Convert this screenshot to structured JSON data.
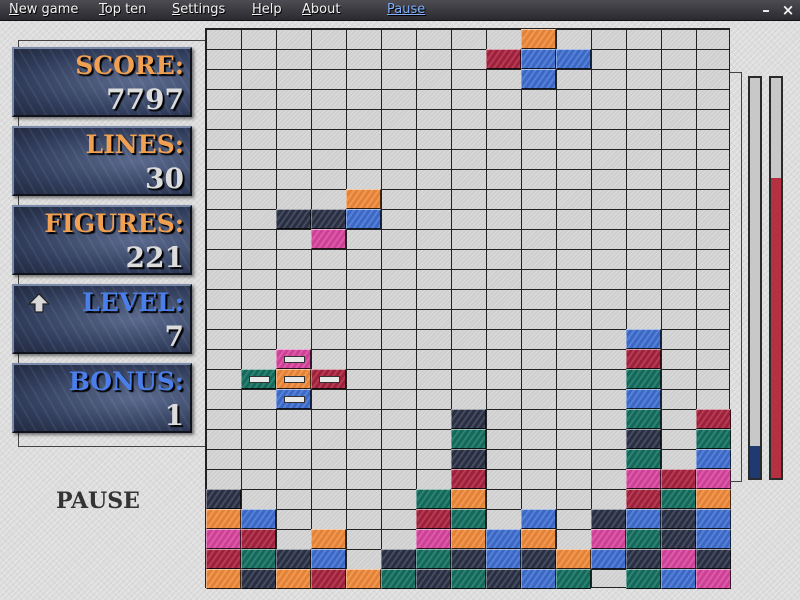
{
  "menu": {
    "items": [
      "New game",
      "Top ten",
      "Settings",
      "Help",
      "About",
      "Pause"
    ],
    "minimize_glyph": "–",
    "close_glyph": "×"
  },
  "stats": {
    "score": {
      "label": "SCORE:",
      "value": "7797"
    },
    "lines": {
      "label": "LINES:",
      "value": "30"
    },
    "figures": {
      "label": "FIGURES:",
      "value": "221"
    },
    "level": {
      "label": "LEVEL:",
      "value": "7",
      "icon": "arrow-up-icon"
    },
    "bonus": {
      "label": "BONUS:",
      "value": "1"
    }
  },
  "status_text": "PAUSE",
  "colors": {
    "O": "#f08a3a",
    "B": "#3f6fd0",
    "R": "#a8223e",
    "T": "#137060",
    "D": "#2c3247",
    "P": "#d9449e",
    "label_orange": "#f0a050",
    "label_blue": "#4a7ee8",
    "meter_blue": "#1e3a70",
    "meter_red": "#b53040"
  },
  "board": {
    "columns": 15,
    "rows": 28,
    "cells": [
      [
        0,
        9,
        "O"
      ],
      [
        1,
        8,
        "R"
      ],
      [
        1,
        9,
        "B"
      ],
      [
        1,
        10,
        "B"
      ],
      [
        2,
        9,
        "B"
      ],
      [
        8,
        4,
        "O"
      ],
      [
        9,
        2,
        "D"
      ],
      [
        9,
        3,
        "D"
      ],
      [
        9,
        4,
        "B"
      ],
      [
        10,
        3,
        "P"
      ],
      [
        15,
        12,
        "B"
      ],
      [
        16,
        12,
        "R"
      ],
      [
        17,
        12,
        "T"
      ],
      [
        18,
        12,
        "B"
      ],
      [
        19,
        7,
        "D"
      ],
      [
        19,
        12,
        "T"
      ],
      [
        19,
        14,
        "R"
      ],
      [
        20,
        7,
        "T"
      ],
      [
        20,
        12,
        "D"
      ],
      [
        20,
        14,
        "T"
      ],
      [
        21,
        7,
        "D"
      ],
      [
        21,
        12,
        "T"
      ],
      [
        21,
        14,
        "B"
      ],
      [
        22,
        7,
        "R"
      ],
      [
        22,
        12,
        "P"
      ],
      [
        22,
        13,
        "R"
      ],
      [
        22,
        14,
        "P"
      ],
      [
        23,
        0,
        "D"
      ],
      [
        23,
        6,
        "T"
      ],
      [
        23,
        7,
        "O"
      ],
      [
        23,
        12,
        "R"
      ],
      [
        23,
        13,
        "T"
      ],
      [
        23,
        14,
        "O"
      ],
      [
        24,
        0,
        "O"
      ],
      [
        24,
        1,
        "B"
      ],
      [
        24,
        6,
        "R"
      ],
      [
        24,
        7,
        "T"
      ],
      [
        24,
        9,
        "B"
      ],
      [
        24,
        11,
        "D"
      ],
      [
        24,
        12,
        "B"
      ],
      [
        24,
        13,
        "D"
      ],
      [
        24,
        14,
        "B"
      ],
      [
        25,
        0,
        "P"
      ],
      [
        25,
        1,
        "R"
      ],
      [
        25,
        3,
        "O"
      ],
      [
        25,
        6,
        "P"
      ],
      [
        25,
        7,
        "O"
      ],
      [
        25,
        8,
        "B"
      ],
      [
        25,
        9,
        "O"
      ],
      [
        25,
        11,
        "P"
      ],
      [
        25,
        12,
        "T"
      ],
      [
        25,
        13,
        "D"
      ],
      [
        25,
        14,
        "B"
      ],
      [
        26,
        0,
        "R"
      ],
      [
        26,
        1,
        "T"
      ],
      [
        26,
        2,
        "D"
      ],
      [
        26,
        3,
        "B"
      ],
      [
        26,
        5,
        "D"
      ],
      [
        26,
        6,
        "T"
      ],
      [
        26,
        7,
        "D"
      ],
      [
        26,
        8,
        "B"
      ],
      [
        26,
        9,
        "D"
      ],
      [
        26,
        10,
        "O"
      ],
      [
        26,
        11,
        "B"
      ],
      [
        26,
        12,
        "D"
      ],
      [
        26,
        13,
        "P"
      ],
      [
        26,
        14,
        "D"
      ],
      [
        27,
        0,
        "O"
      ],
      [
        27,
        1,
        "D"
      ],
      [
        27,
        2,
        "O"
      ],
      [
        27,
        3,
        "R"
      ],
      [
        27,
        4,
        "O"
      ],
      [
        27,
        5,
        "T"
      ],
      [
        27,
        6,
        "D"
      ],
      [
        27,
        7,
        "T"
      ],
      [
        27,
        8,
        "D"
      ],
      [
        27,
        9,
        "B"
      ],
      [
        27,
        10,
        "T"
      ],
      [
        27,
        12,
        "T"
      ],
      [
        27,
        13,
        "B"
      ],
      [
        27,
        14,
        "P"
      ]
    ],
    "bonus_cells": [
      [
        16,
        2,
        "P"
      ],
      [
        17,
        1,
        "T"
      ],
      [
        17,
        2,
        "O"
      ],
      [
        17,
        3,
        "R"
      ],
      [
        18,
        2,
        "B"
      ]
    ]
  },
  "meters": {
    "left": {
      "level": 0.08,
      "color": "#1e3a70"
    },
    "right": {
      "level": 0.75,
      "color": "#b53040"
    }
  }
}
